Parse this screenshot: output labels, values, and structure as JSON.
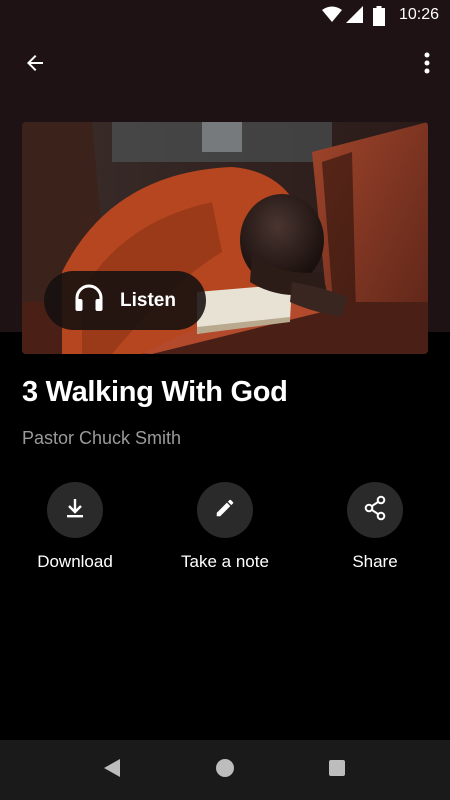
{
  "status_bar": {
    "time": "10:26"
  },
  "app_bar": {
    "back_icon": "arrow-back-icon",
    "more_icon": "more-vert-icon"
  },
  "hero": {
    "listen_label": "Listen",
    "listen_icon": "headphones-icon"
  },
  "content": {
    "title": "3 Walking With God",
    "author": "Pastor Chuck Smith"
  },
  "actions": [
    {
      "label": "Download",
      "icon": "download-icon"
    },
    {
      "label": "Take a note",
      "icon": "pencil-icon"
    },
    {
      "label": "Share",
      "icon": "share-icon"
    }
  ],
  "nav_bar": {
    "icons": [
      "back-triangle-icon",
      "home-circle-icon",
      "recents-square-icon"
    ]
  },
  "colors": {
    "header_bg": "#1e1215",
    "page_bg": "#000000",
    "action_circle": "#2a2a2a",
    "subtitle": "#9a9a9a"
  }
}
